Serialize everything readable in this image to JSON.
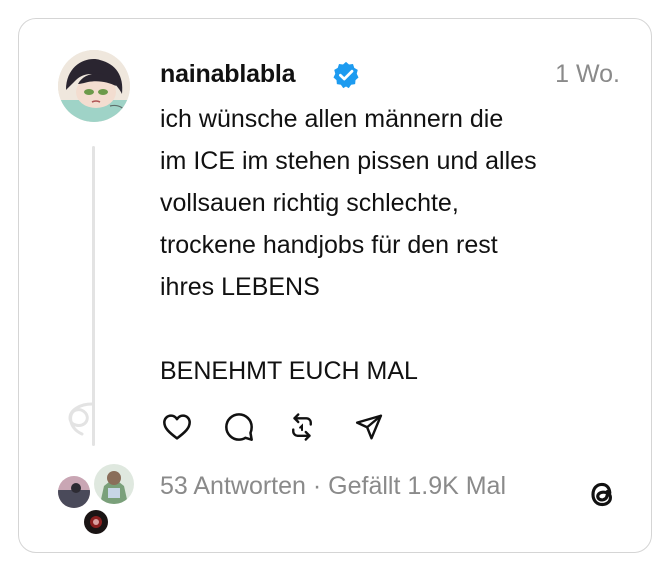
{
  "post": {
    "username": "nainablabla",
    "verified": true,
    "timestamp": "1 Wo.",
    "lines": [
      "ich wünsche allen männern die",
      "im ICE im stehen pissen und alles",
      "vollsauen richtig schlechte,",
      "trockene handjobs für den rest",
      "ihres LEBENS"
    ],
    "closing_line": "BENEHMT EUCH MAL"
  },
  "actions": {
    "like_icon": "heart-icon",
    "reply_icon": "comment-bubble-icon",
    "repost_icon": "repost-arrows-icon",
    "share_icon": "send-paper-plane-icon"
  },
  "footer": {
    "replies": "53 Antworten",
    "separator": " · ",
    "likes": "Gefällt 1.9K Mal"
  },
  "colors": {
    "text": "#111111",
    "muted": "#8a8a8a",
    "verified_badge": "#1d9bf0",
    "card_border": "#d5d5d5",
    "thread_line": "#e3e3e3"
  }
}
